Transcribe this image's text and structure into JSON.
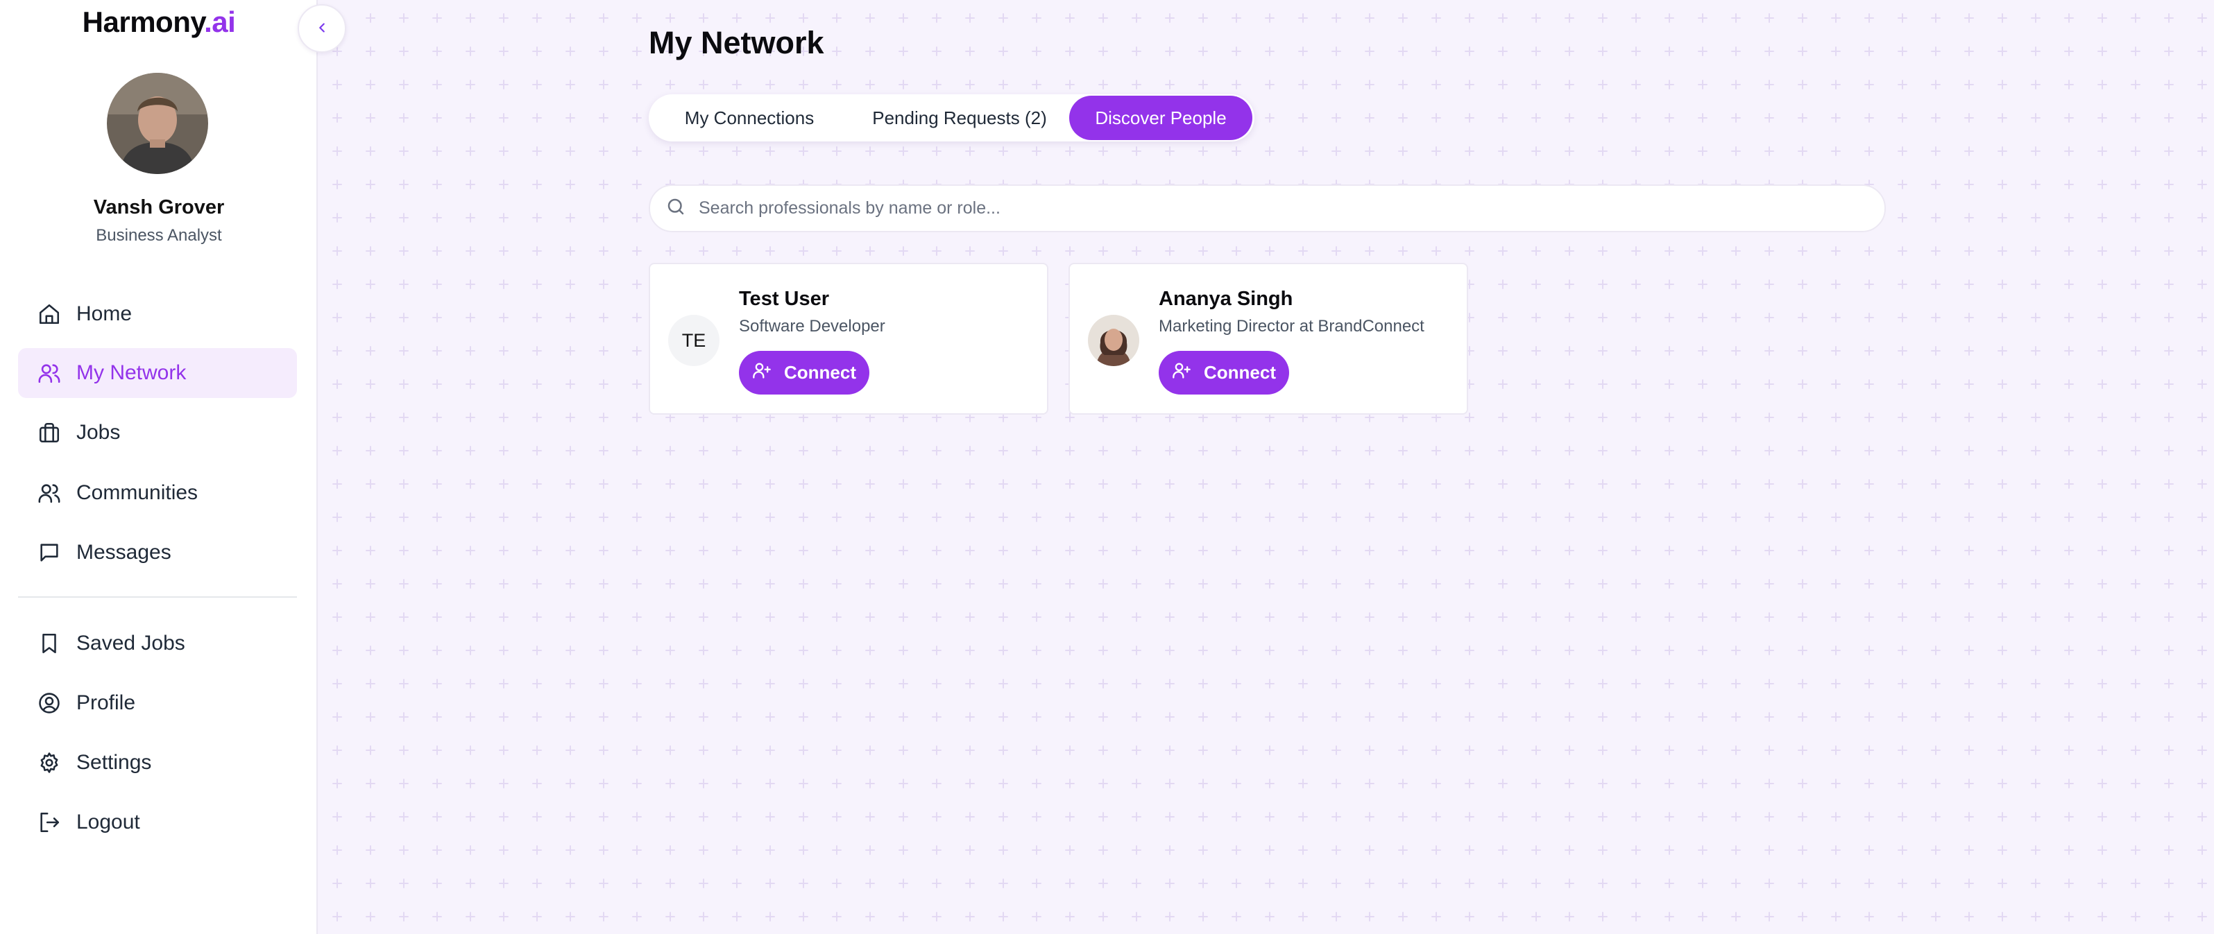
{
  "brand": {
    "name": "Harmony",
    "suffix": ".ai"
  },
  "colors": {
    "accent": "#9333ea",
    "active_bg": "#f5ecfd",
    "page_bg": "#f7f3fd"
  },
  "user": {
    "name": "Vansh Grover",
    "role": "Business Analyst"
  },
  "sidebar": {
    "items": [
      {
        "label": "Home",
        "icon": "home-icon"
      },
      {
        "label": "My Network",
        "icon": "users-icon",
        "active": true
      },
      {
        "label": "Jobs",
        "icon": "briefcase-icon"
      },
      {
        "label": "Communities",
        "icon": "community-icon"
      },
      {
        "label": "Messages",
        "icon": "message-icon"
      },
      {
        "label": "Saved Jobs",
        "icon": "bookmark-icon"
      },
      {
        "label": "Profile",
        "icon": "profile-icon"
      },
      {
        "label": "Settings",
        "icon": "gear-icon"
      },
      {
        "label": "Logout",
        "icon": "logout-icon"
      }
    ]
  },
  "main": {
    "title": "My Network",
    "tabs": [
      {
        "label": "My Connections"
      },
      {
        "label": "Pending Requests (2)"
      },
      {
        "label": "Discover People",
        "active": true
      }
    ],
    "search": {
      "placeholder": "Search professionals by name or role..."
    },
    "people": [
      {
        "initials": "TE",
        "name": "Test User",
        "title": "Software Developer",
        "button": "Connect"
      },
      {
        "name": "Ananya Singh",
        "title": "Marketing Director at BrandConnect",
        "button": "Connect"
      }
    ]
  }
}
